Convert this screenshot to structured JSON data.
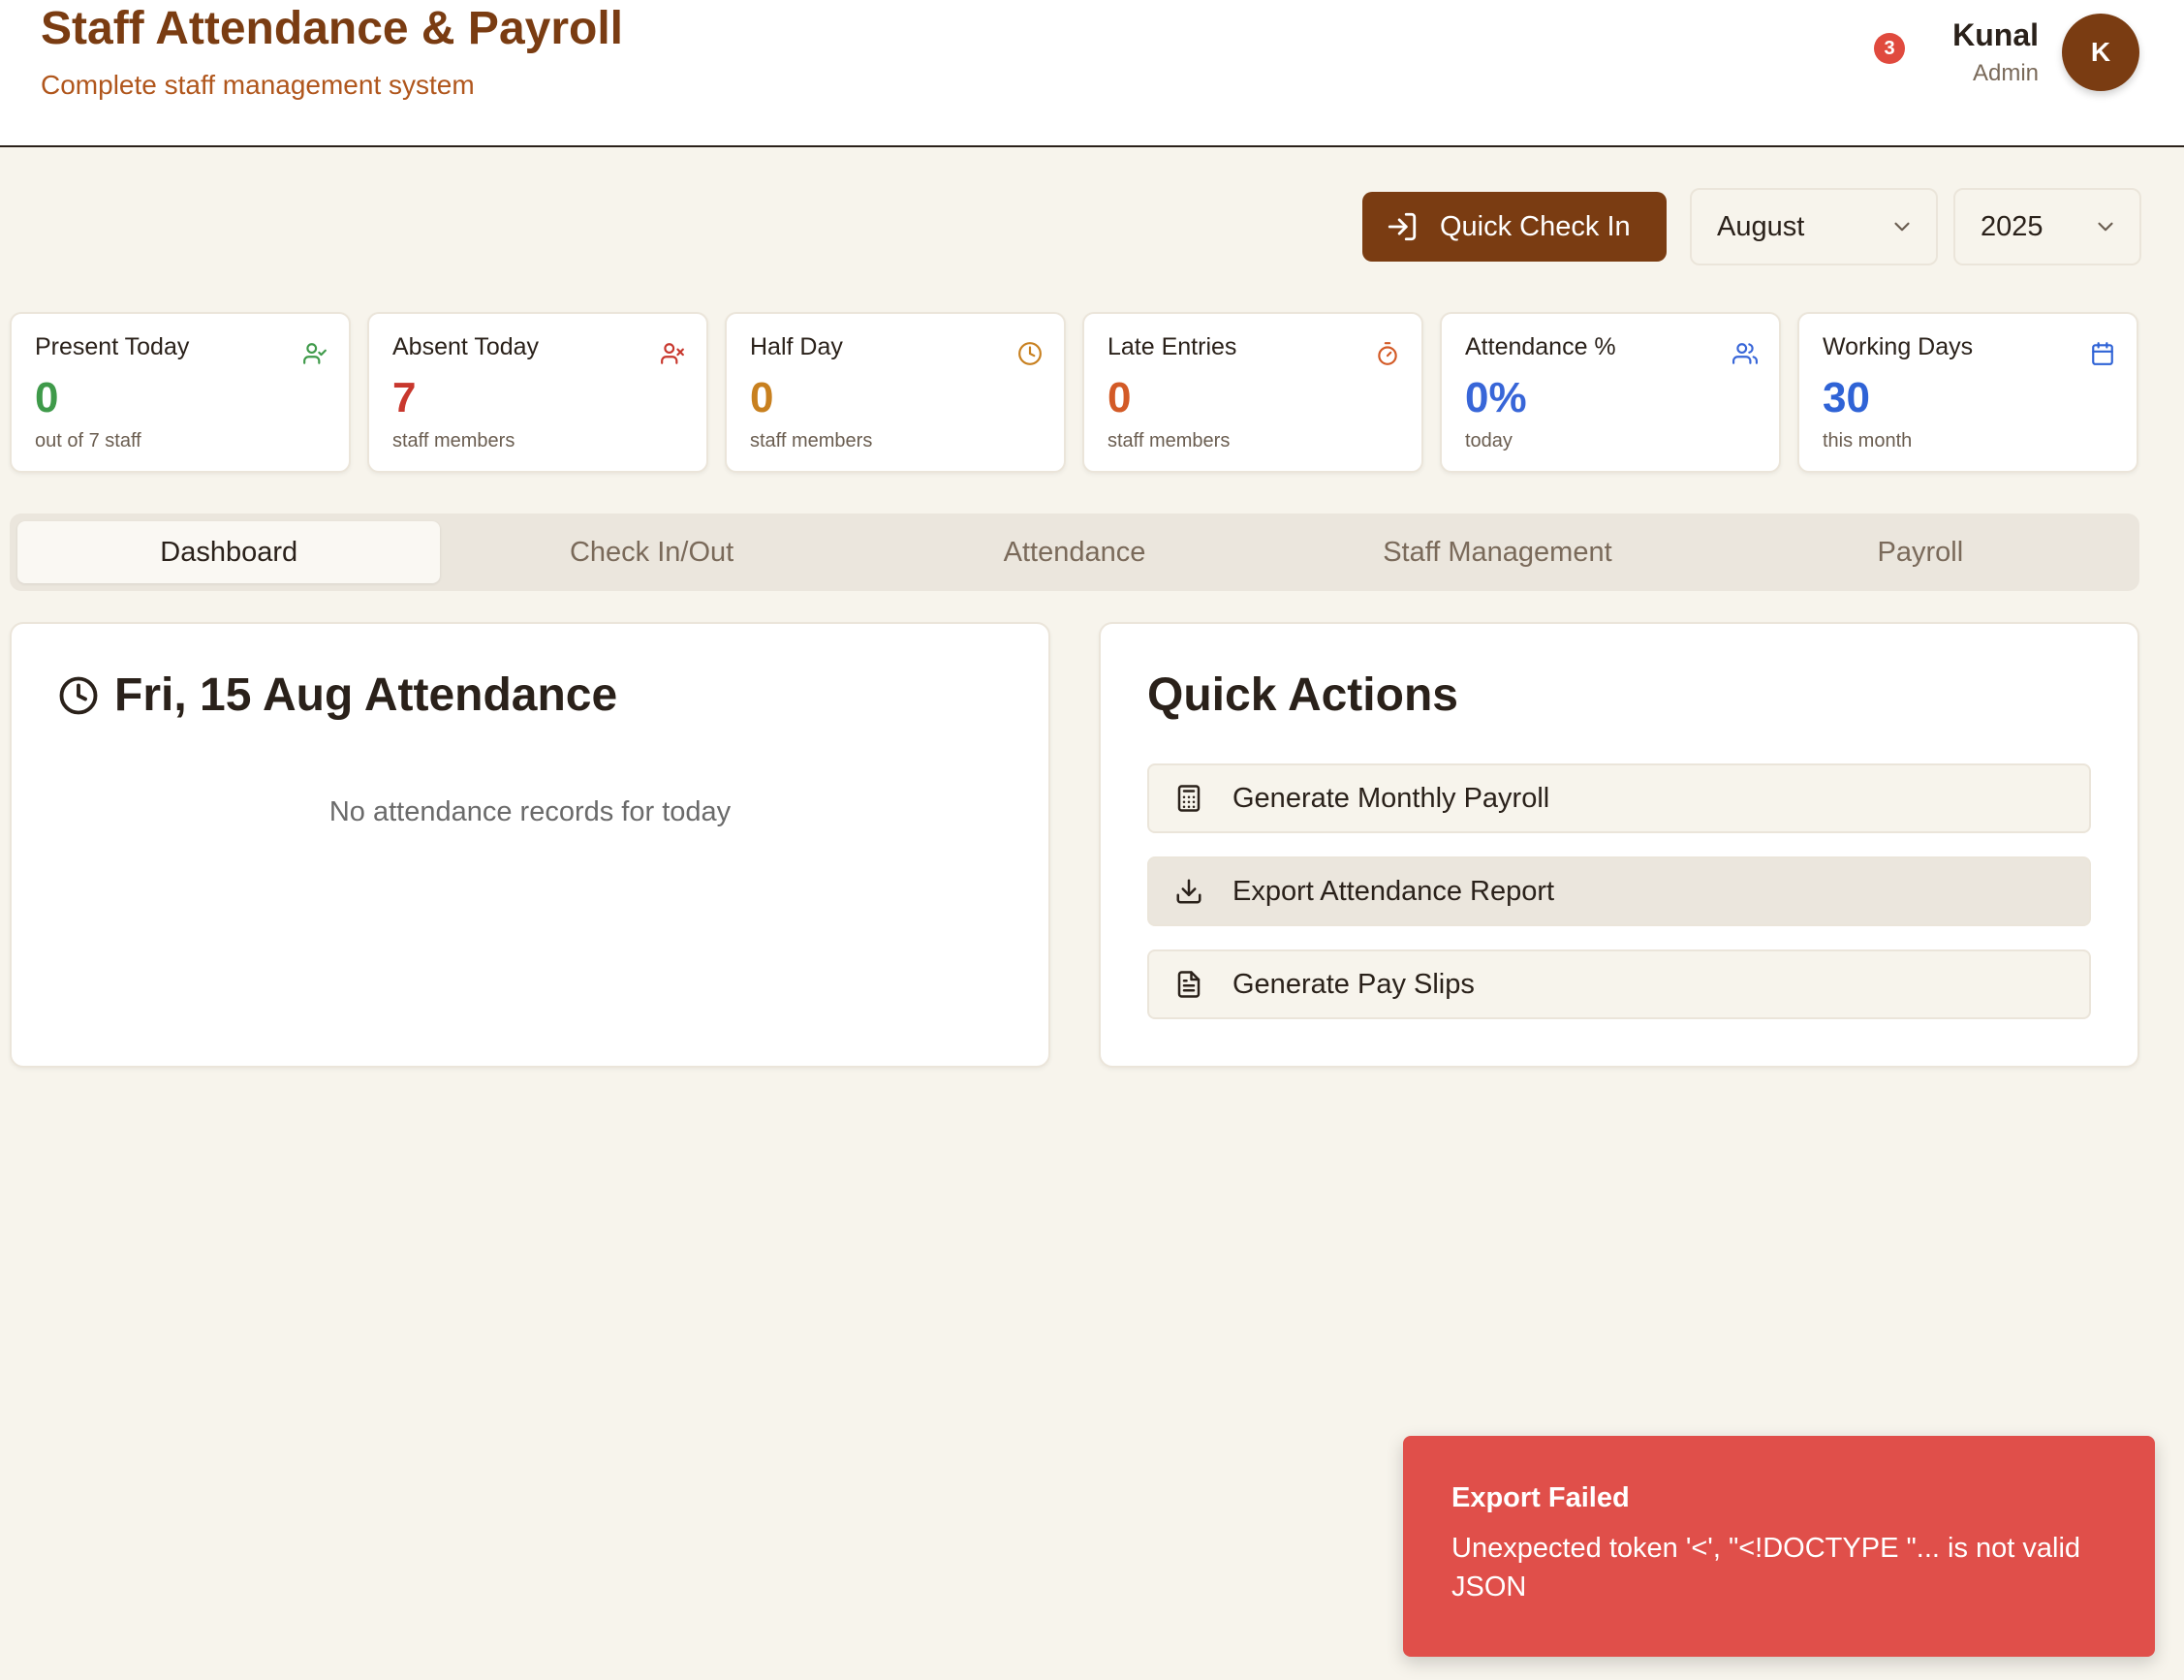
{
  "header": {
    "title": "Staff Attendance & Payroll",
    "subtitle": "Complete staff management system",
    "notification_count": "3",
    "user_name": "Kunal",
    "user_role": "Admin",
    "avatar_initial": "K"
  },
  "toolbar": {
    "check_in_label": "Quick Check In",
    "month_selected": "August",
    "year_selected": "2025"
  },
  "stats": [
    {
      "label": "Present Today",
      "value": "0",
      "sub": "out of 7 staff",
      "icon": "user-check-icon",
      "color": "#3f9a4a"
    },
    {
      "label": "Absent Today",
      "value": "7",
      "sub": "staff members",
      "icon": "user-x-icon",
      "color": "#c8372d"
    },
    {
      "label": "Half Day",
      "value": "0",
      "sub": "staff members",
      "icon": "clock-icon",
      "color": "#c8801f"
    },
    {
      "label": "Late Entries",
      "value": "0",
      "sub": "staff members",
      "icon": "timer-icon",
      "color": "#d35a26"
    },
    {
      "label": "Attendance %",
      "value": "0%",
      "sub": "today",
      "icon": "users-icon",
      "color": "#3866d8"
    },
    {
      "label": "Working Days",
      "value": "30",
      "sub": "this month",
      "icon": "calendar-icon",
      "color": "#2f63d6"
    }
  ],
  "tabs": [
    {
      "label": "Dashboard",
      "active": true
    },
    {
      "label": "Check In/Out"
    },
    {
      "label": "Attendance"
    },
    {
      "label": "Staff Management"
    },
    {
      "label": "Payroll"
    }
  ],
  "attendance_panel": {
    "title": "Fri, 15 Aug Attendance",
    "empty_message": "No attendance records for today"
  },
  "quick_actions": {
    "title": "Quick Actions",
    "items": [
      {
        "label": "Generate Monthly Payroll",
        "icon": "calculator-icon"
      },
      {
        "label": "Export Attendance Report",
        "icon": "download-icon"
      },
      {
        "label": "Generate Pay Slips",
        "icon": "file-text-icon"
      }
    ]
  },
  "toast": {
    "title": "Export Failed",
    "message": "Unexpected token '<', \"<!DOCTYPE \"... is not valid JSON",
    "color": "#e04f4a"
  },
  "colors": {
    "brand": "#7a3c12",
    "background": "#f7f4ec"
  }
}
